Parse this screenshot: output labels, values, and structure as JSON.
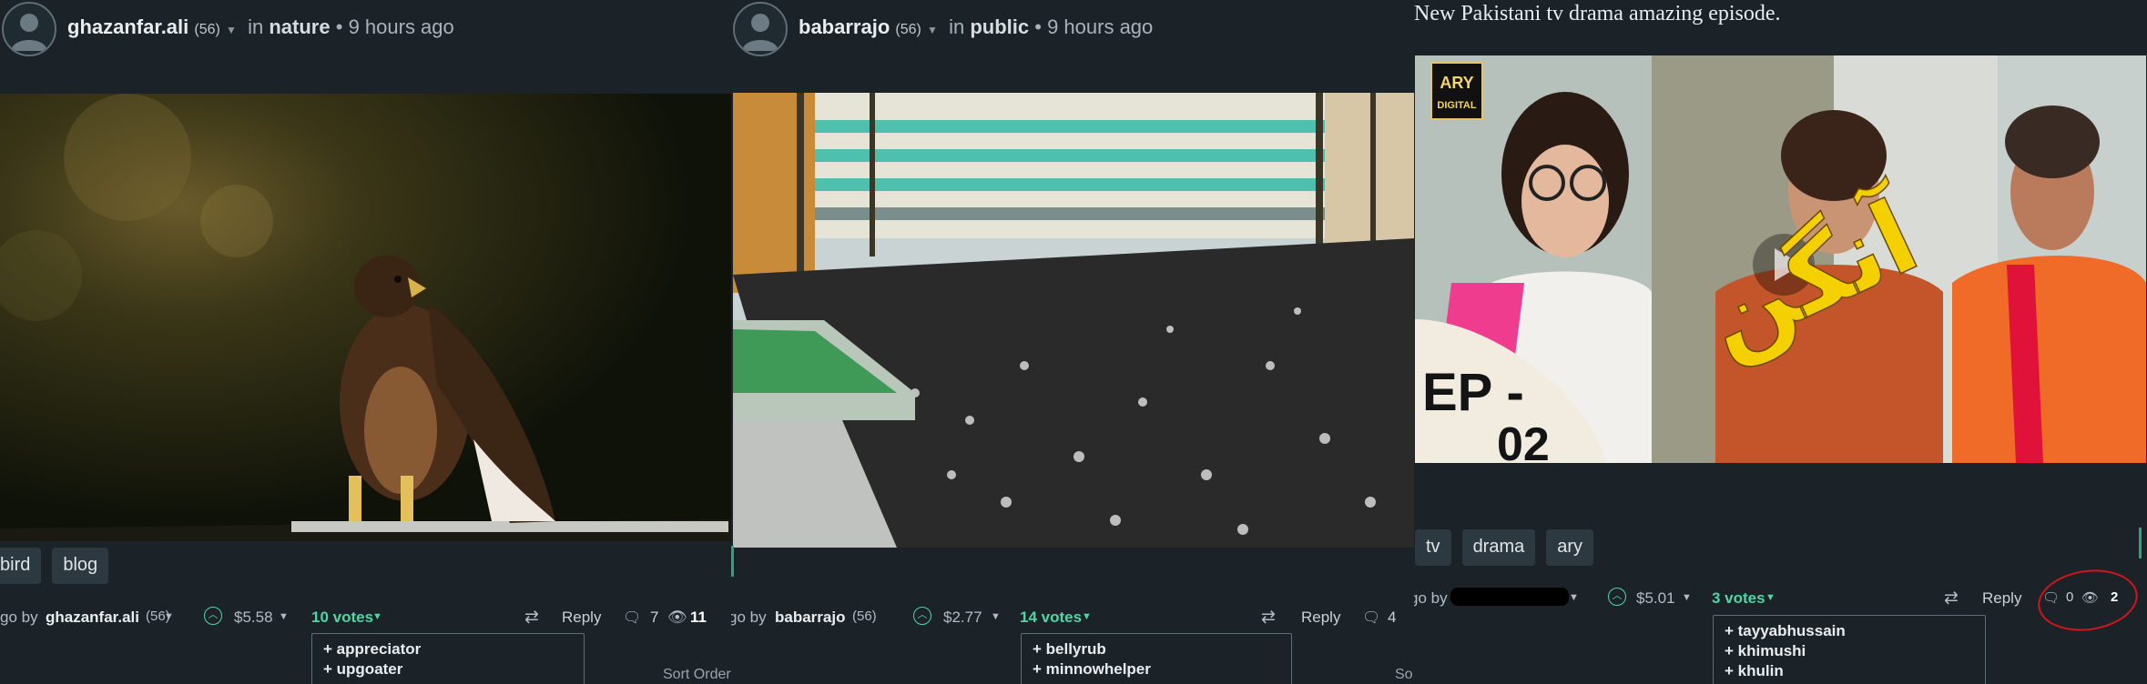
{
  "posts": [
    {
      "author": "ghazanfar.ali",
      "reputation": "(56)",
      "in_label": "in",
      "category": "nature",
      "time": "9 hours ago",
      "tags": [
        "bird",
        "blog"
      ],
      "footer": {
        "by_prefix": "go by",
        "by_name": "ghazanfar.ali",
        "by_rep": "(56)",
        "payout": "$5.58",
        "votes": "10 votes",
        "reply": "Reply",
        "comments": "7",
        "views": "11"
      },
      "voters": [
        "+ appreciator",
        "+ upgoater",
        "+ ..."
      ],
      "sort_label": "Sort Order"
    },
    {
      "author": "babarrajo",
      "reputation": "(56)",
      "in_label": "in",
      "category": "public",
      "time": "9 hours ago",
      "footer": {
        "by_prefix": "go by",
        "by_name": "babarrajo",
        "by_rep": "(56)",
        "payout": "$2.77",
        "votes": "14 votes",
        "reply": "Reply",
        "comments": "4"
      },
      "voters": [
        "+ bellyrub",
        "+ minnowhelper",
        "+ ..."
      ],
      "sort_label": "So"
    },
    {
      "title": "New Pakistani tv drama amazing episode.",
      "thumbnail": {
        "channel_top": "ARY",
        "channel_bottom": "DIGITAL",
        "episode": "EP -",
        "episode_num": "02",
        "title_urdu": "آنگن"
      },
      "tags": [
        "tv",
        "drama",
        "ary"
      ],
      "footer": {
        "by_prefix": "go by",
        "payout": "$5.01",
        "votes": "3 votes",
        "reply": "Reply",
        "comments": "0",
        "views": "2"
      },
      "voters": [
        "+ tayyabhussain",
        "+ khimushi",
        "+ khulin"
      ]
    }
  ],
  "icons": {
    "upvote": "chevron-up-circle-icon",
    "reblog": "reblog-icon",
    "comments": "comments-icon",
    "views": "eye-icon",
    "caret": "caret-down-icon"
  },
  "colors": {
    "background": "#1b2329",
    "accent_green": "#52d4a5",
    "tag_bg": "#2d3940",
    "annotation_red": "#d0151b"
  }
}
